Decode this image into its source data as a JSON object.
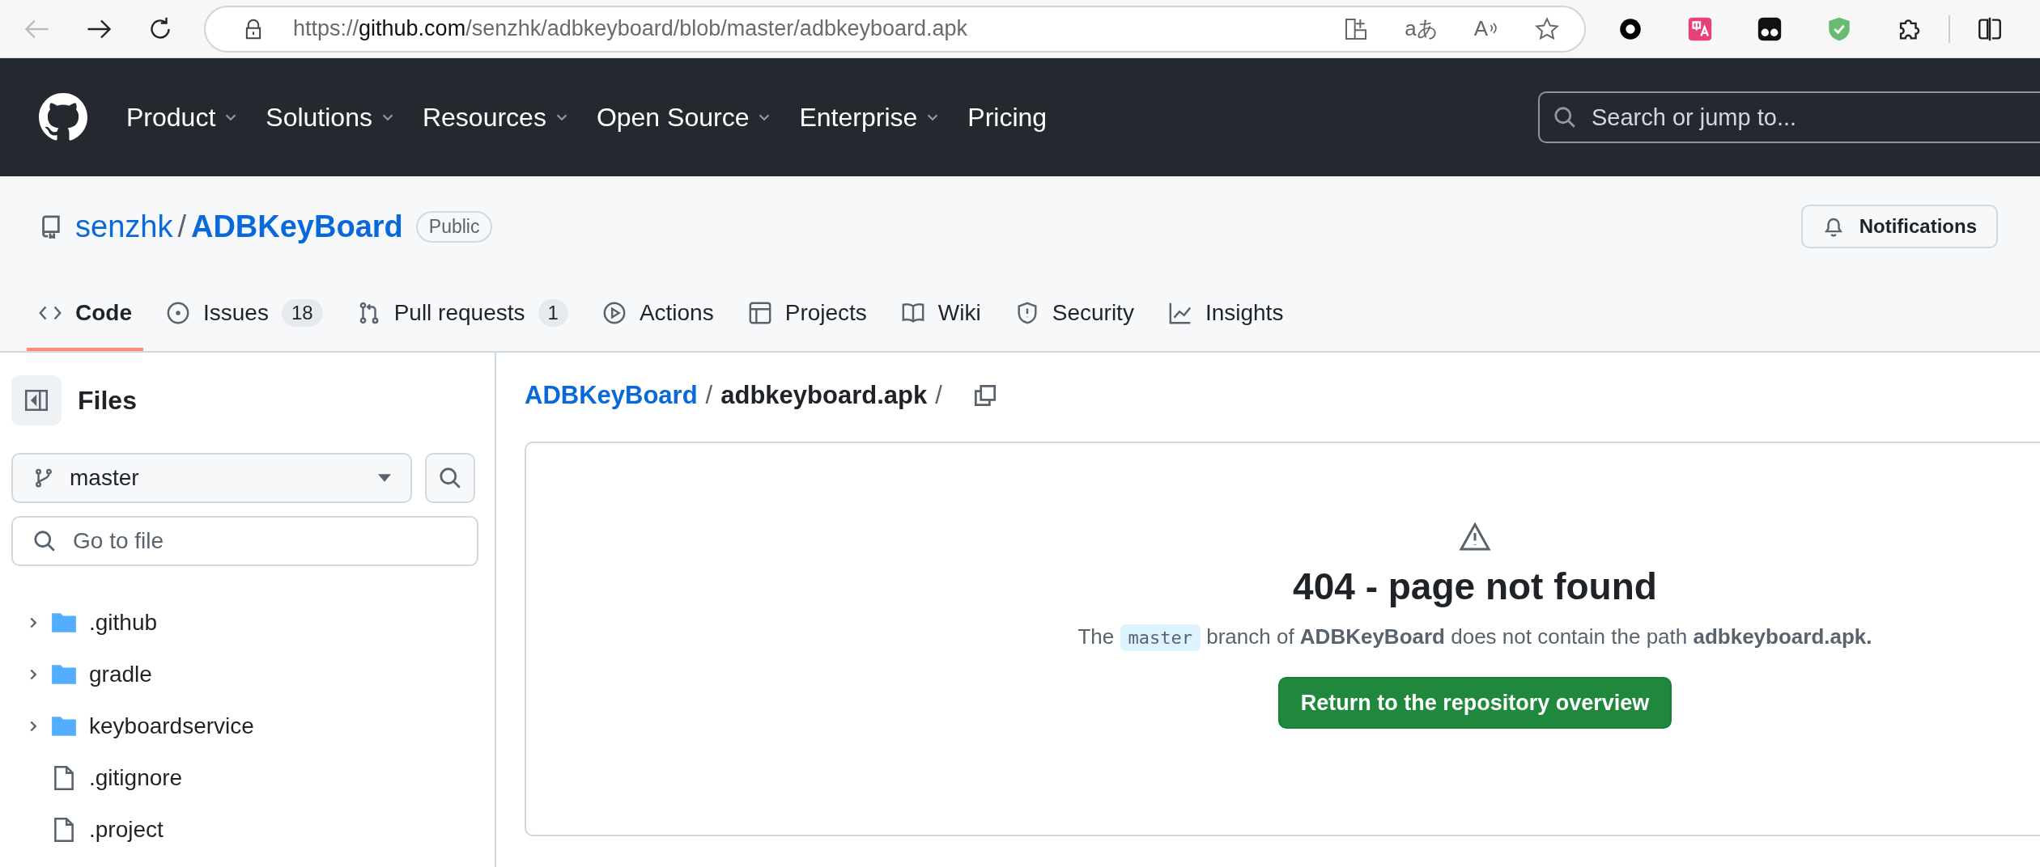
{
  "browser": {
    "back": {
      "disabled": true
    },
    "url": [
      {
        "text": "https://",
        "strong": false
      },
      {
        "text": "github.com",
        "strong": true
      },
      {
        "text": "/senzhk/adbkeyboard/blob/master/adbkeyboard.apk",
        "strong": false
      }
    ],
    "translate_glyph": "aあ",
    "read_aloud_glyph": "A"
  },
  "header": {
    "nav": [
      {
        "label": "Product",
        "dropdown": true
      },
      {
        "label": "Solutions",
        "dropdown": true
      },
      {
        "label": "Resources",
        "dropdown": true
      },
      {
        "label": "Open Source",
        "dropdown": true
      },
      {
        "label": "Enterprise",
        "dropdown": true
      },
      {
        "label": "Pricing",
        "dropdown": false
      }
    ],
    "search": {
      "placeholder": "Search or jump to..."
    }
  },
  "repo": {
    "owner": "senzhk",
    "separator": "/",
    "name": "ADBKeyBoard",
    "visibility": "Public",
    "notifications": "Notifications"
  },
  "tabs": [
    {
      "label": "Code",
      "kind": "code",
      "selected": true
    },
    {
      "label": "Issues",
      "kind": "issues",
      "count": "18",
      "selected": false
    },
    {
      "label": "Pull requests",
      "kind": "pull-requests",
      "count": "1",
      "selected": false
    },
    {
      "label": "Actions",
      "kind": "actions",
      "selected": false
    },
    {
      "label": "Projects",
      "kind": "projects",
      "selected": false
    },
    {
      "label": "Wiki",
      "kind": "wiki",
      "selected": false
    },
    {
      "label": "Security",
      "kind": "security",
      "selected": false
    },
    {
      "label": "Insights",
      "kind": "insights",
      "selected": false
    }
  ],
  "sidebar": {
    "title": "Files",
    "branch": "master",
    "filter": {
      "placeholder": "Go to file"
    },
    "tree": [
      {
        "name": ".github",
        "kind": "folder",
        "expanded": false
      },
      {
        "name": "gradle",
        "kind": "folder",
        "expanded": false
      },
      {
        "name": "keyboardservice",
        "kind": "folder",
        "expanded": false
      },
      {
        "name": ".gitignore",
        "kind": "file"
      },
      {
        "name": ".project",
        "kind": "file"
      }
    ]
  },
  "breadcrumb": {
    "repo": "ADBKeyBoard",
    "file": "adbkeyboard.apk",
    "separator": "/"
  },
  "error": {
    "title": "404 - page not found",
    "message": [
      {
        "text": "The ",
        "kind": "plain"
      },
      {
        "text": "master",
        "kind": "code"
      },
      {
        "text": " branch of ",
        "kind": "plain"
      },
      {
        "text": "ADBKeyBoard",
        "kind": "bold"
      },
      {
        "text": " does not contain the path ",
        "kind": "plain"
      },
      {
        "text": "adbkeyboard.apk.",
        "kind": "bold"
      }
    ],
    "button": "Return to the repository overview"
  }
}
